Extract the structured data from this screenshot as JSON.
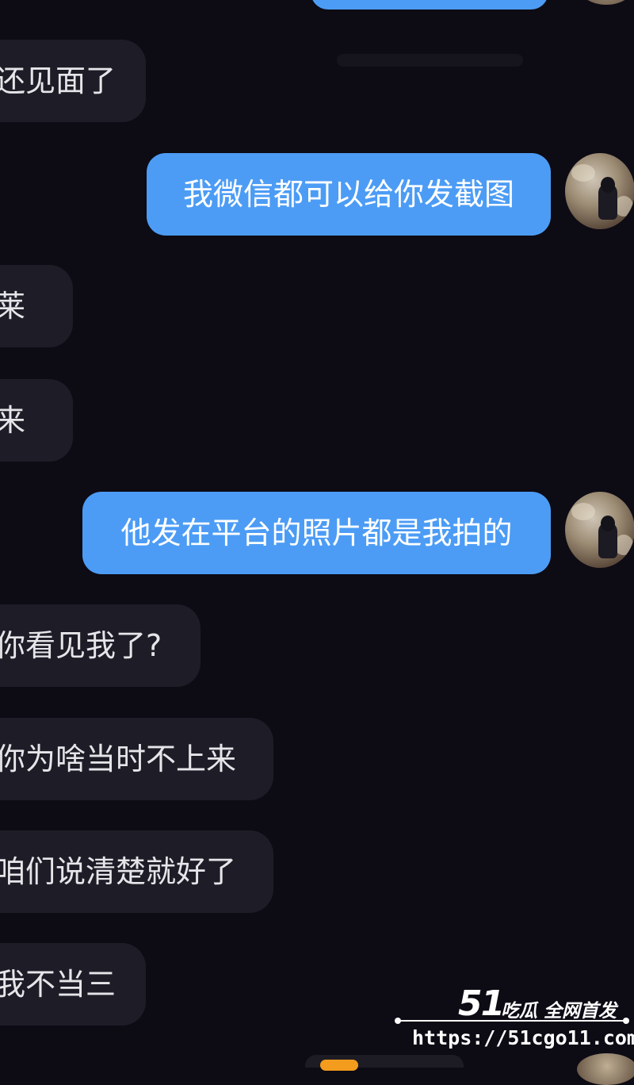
{
  "messages": [
    {
      "side": "incoming",
      "text": "还见面了"
    },
    {
      "side": "outgoing",
      "text": "我微信都可以给你发截图"
    },
    {
      "side": "incoming",
      "text": "莱"
    },
    {
      "side": "incoming",
      "text": "来"
    },
    {
      "side": "outgoing",
      "text": "他发在平台的照片都是我拍的"
    },
    {
      "side": "incoming",
      "text": "你看见我了?"
    },
    {
      "side": "incoming",
      "text": "你为啥当时不上来"
    },
    {
      "side": "incoming",
      "text": "咱们说清楚就好了"
    },
    {
      "side": "incoming",
      "text": "我不当三"
    }
  ],
  "watermark": {
    "brand": "51",
    "slogan": "吃瓜 全网首发",
    "url": "https://51cgo11.com"
  },
  "colors": {
    "background": "#0d0b14",
    "incoming_bubble": "#1e1d27",
    "outgoing_bubble": "#4c9cf5"
  }
}
